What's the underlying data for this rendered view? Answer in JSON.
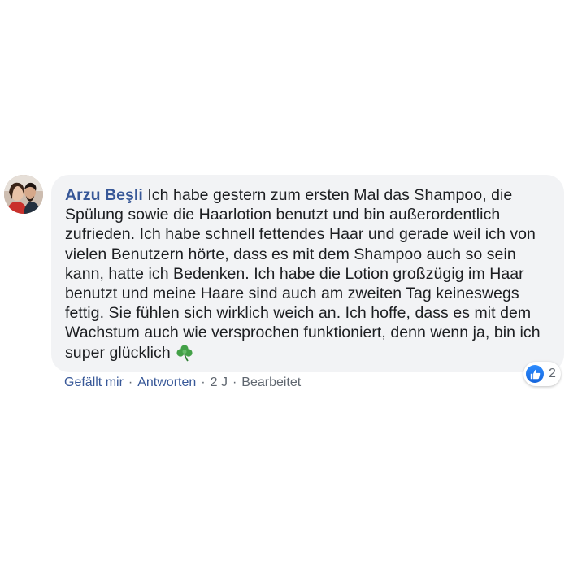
{
  "comment": {
    "author": "Arzu Beşli",
    "text": "Ich habe gestern zum ersten Mal das Shampoo, die Spülung sowie die Haarlotion benutzt und bin außerordentlich zufrieden. Ich habe schnell fettendes Haar und gerade weil ich von vielen Benutzern hörte, dass es mit dem Shampoo auch so sein kann, hatte ich Bedenken. Ich habe die Lotion großzügig im Haar benutzt und meine Haare sind auch am zweiten Tag keineswegs fettig. Sie fühlen sich wirklich weich an. Ich hoffe, dass es mit dem Wachstum auch wie versprochen funktioniert, denn wenn ja, bin ich super glücklich",
    "emoji": "clover-icon",
    "reaction_icon": "like-icon",
    "reaction_count": "2"
  },
  "actions": {
    "like_label": "Gefällt mir",
    "reply_label": "Antworten",
    "time_label": "2 J",
    "edited_label": "Bearbeitet",
    "separator": "·"
  },
  "colors": {
    "link": "#385898",
    "bubble": "#f2f3f5",
    "text": "#1c1e21",
    "meta": "#606770",
    "like_blue": "#1877f2",
    "clover_green": "#4caf50"
  }
}
